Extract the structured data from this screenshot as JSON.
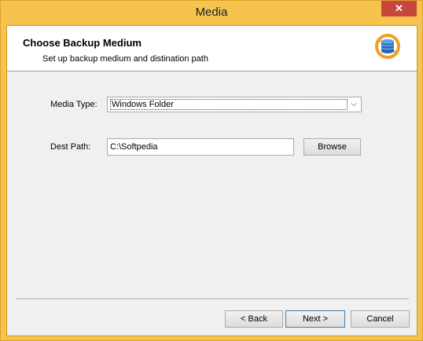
{
  "window": {
    "title": "Media",
    "close_glyph": "✕"
  },
  "header": {
    "title": "Choose Backup Medium",
    "subtitle": "Set up backup medium and distination path",
    "icon": "backup-database-icon"
  },
  "form": {
    "media_type_label": "Media Type:",
    "media_type_value": "Windows Folder",
    "dest_path_label": "Dest Path:",
    "dest_path_value": "C:\\Softpedia",
    "browse_label": "Browse"
  },
  "footer": {
    "back_label": "< Back",
    "next_label": "Next >",
    "cancel_label": "Cancel"
  },
  "colors": {
    "frame": "#f6c44e",
    "close_button": "#c7453b",
    "client_background": "#f0f0f0"
  }
}
